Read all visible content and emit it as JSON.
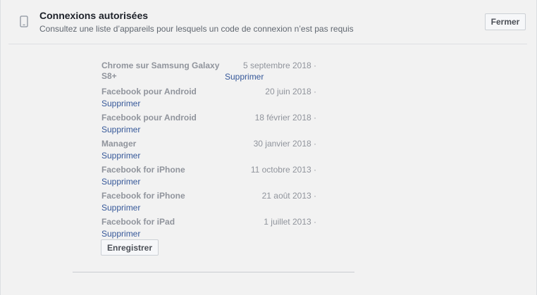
{
  "header": {
    "title": "Connexions autorisées",
    "subtitle": "Consultez une liste d’appareils pour lesquels un code de connexion n’est pas requis",
    "close_label": "Fermer",
    "icon": "mobile-phone-icon"
  },
  "devices": [
    {
      "name": "Chrome sur Samsung Galaxy S8+",
      "date": "5 septembre 2018 ·",
      "remove_label": "Supprimer"
    },
    {
      "name": "Facebook pour Android",
      "date": "20 juin 2018 ·",
      "remove_label": "Supprimer"
    },
    {
      "name": "Facebook pour Android",
      "date": "18 février 2018 ·",
      "remove_label": "Supprimer"
    },
    {
      "name": "Manager",
      "date": "30 janvier 2018 ·",
      "remove_label": "Supprimer"
    },
    {
      "name": "Facebook for iPhone",
      "date": "11 octobre 2013 ·",
      "remove_label": "Supprimer"
    },
    {
      "name": "Facebook for iPhone",
      "date": "21 août 2013 ·",
      "remove_label": "Supprimer"
    },
    {
      "name": "Facebook for iPad",
      "date": "1 juillet 2013 ·",
      "remove_label": "Supprimer"
    }
  ],
  "save_label": "Enregistrer"
}
